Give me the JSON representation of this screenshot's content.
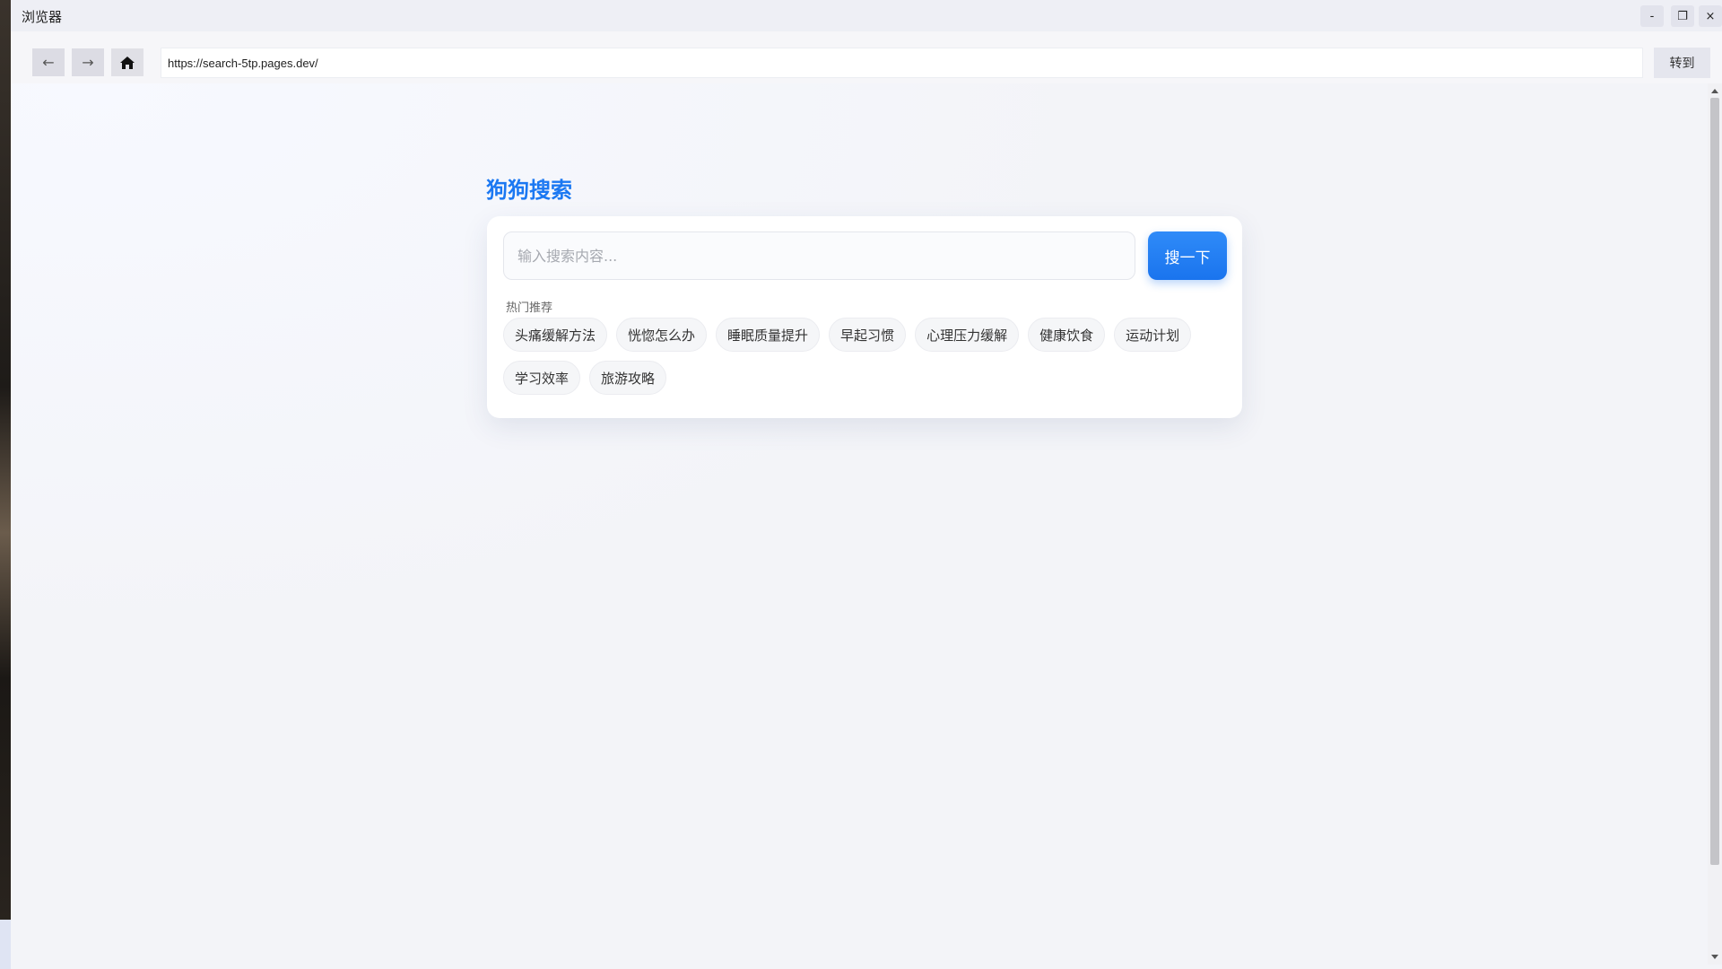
{
  "window": {
    "title": "浏览器",
    "minimize_label": "-",
    "maximize_label": "❐",
    "close_label": "×"
  },
  "nav": {
    "back_label": "←",
    "forward_label": "→",
    "url": "https://search-5tp.pages.dev/",
    "go_label": "转到"
  },
  "page": {
    "brand": "狗狗搜索",
    "search_placeholder": "输入搜索内容...",
    "search_button": "搜一下",
    "hot_label": "热门推荐",
    "hot_items": [
      "头痛缓解方法",
      "恍惚怎么办",
      "睡眠质量提升",
      "早起习惯",
      "心理压力缓解",
      "健康饮食",
      "运动计划",
      "学习效率",
      "旅游攻略"
    ]
  },
  "colors": {
    "accent": "#1b78f2",
    "background": "#f3f4f8"
  }
}
